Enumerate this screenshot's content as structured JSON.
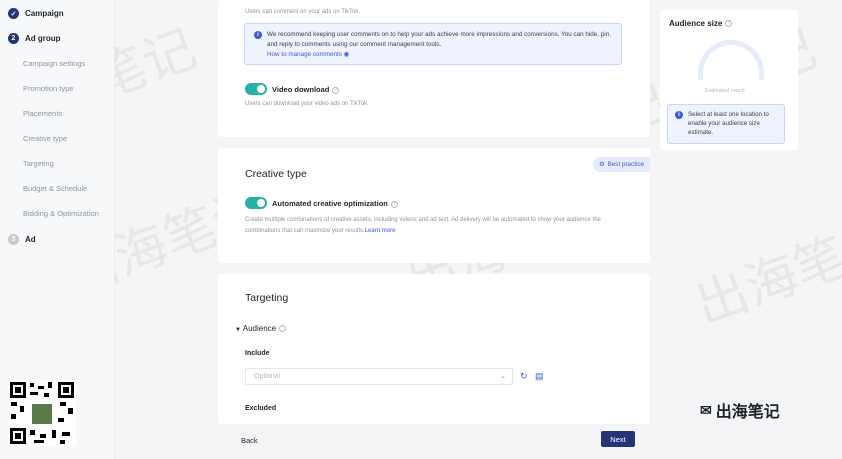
{
  "sidebar": {
    "campaign": "Campaign",
    "ad_group": "Ad group",
    "ad_group_num": "2",
    "items": [
      "Campaign settings",
      "Promotion type",
      "Placements",
      "Creative type",
      "Targeting",
      "Budget & Schedule",
      "Bidding & Optimization"
    ],
    "ad": "Ad",
    "ad_num": "3"
  },
  "placements_card": {
    "comment_note": "Users can comment on your ads on TikTok.",
    "info_text": "We recommend keeping user comments on to help your ads achieve more impressions and conversions. You can hide, pin, and reply to comments using our comment management tools.",
    "info_link": "How to manage comments",
    "video_download_label": "Video download",
    "video_download_note": "Users can download your video ads on TikTok."
  },
  "creative_card": {
    "title": "Creative type",
    "best_practice": "Best practice",
    "toggle_label": "Automated creative optimization",
    "description": "Create multiple combinations of creative assets, including videos and ad text. Ad delivery will be automated to show your audience the combinations that can maximize your results.",
    "learn_more": "Learn more"
  },
  "targeting_card": {
    "title": "Targeting",
    "audience_label": "Audience",
    "include_label": "Include",
    "include_placeholder": "Optional",
    "excluded_label": "Excluded"
  },
  "right_panel": {
    "title": "Audience size",
    "estimated_reach": "Estimated reach",
    "info": "Select at least one location to enable your audience size estimate."
  },
  "footer": {
    "back": "Back",
    "next": "Next"
  },
  "overlay": {
    "watermark_text": "出海笔记",
    "logo_text": "出海笔记"
  }
}
